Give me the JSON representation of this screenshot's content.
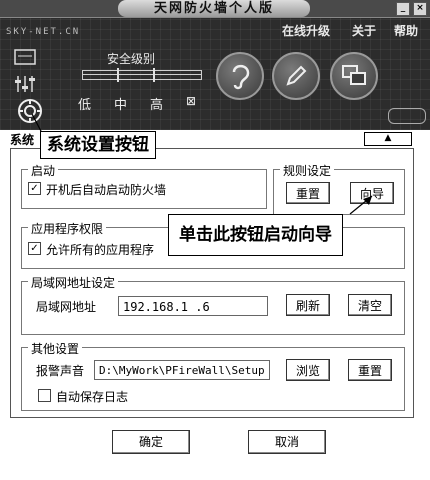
{
  "app": {
    "title": "天网防火墙个人版",
    "brand": "SKY-NET.CN",
    "menu": [
      "在线升级",
      "关于",
      "帮助"
    ],
    "window_buttons": [
      "_",
      "×"
    ]
  },
  "security_level": {
    "label": "安全级别",
    "levels": [
      "低",
      "中",
      "高"
    ],
    "custom_mark": "⊠"
  },
  "tab": {
    "selected_label": "系统"
  },
  "groups": {
    "startup": {
      "title": "启动",
      "checkbox_label": "开机后自动启动防火墙",
      "checked": true
    },
    "rules": {
      "title": "规则设定",
      "reset_label": "重置",
      "wizard_label": "向导"
    },
    "app_permissions": {
      "title": "应用程序权限",
      "checkbox_label": "允许所有的应用程序",
      "checked": true
    },
    "lan": {
      "title": "局域网地址设定",
      "address_label": "局域网地址",
      "address_value": "192.168.1   .6",
      "refresh_label": "刷新",
      "clear_label": "清空"
    },
    "other": {
      "title": "其他设置",
      "alarm_label": "报警声音",
      "alarm_path": "D:\\MyWork\\PFireWall\\Setup",
      "browse_label": "浏览",
      "reset_label": "重置",
      "autosave_label": "自动保存日志",
      "autosave_checked": false
    }
  },
  "footer": {
    "ok_label": "确定",
    "cancel_label": "取消"
  },
  "annotations": {
    "system_settings_button": "系统设置按钮",
    "wizard_hint": "单击此按钮启动向导"
  },
  "icons": [
    "gear-icon",
    "sliders-icon",
    "ear-icon",
    "pen-icon",
    "monitor-icon",
    "tray-icon"
  ]
}
